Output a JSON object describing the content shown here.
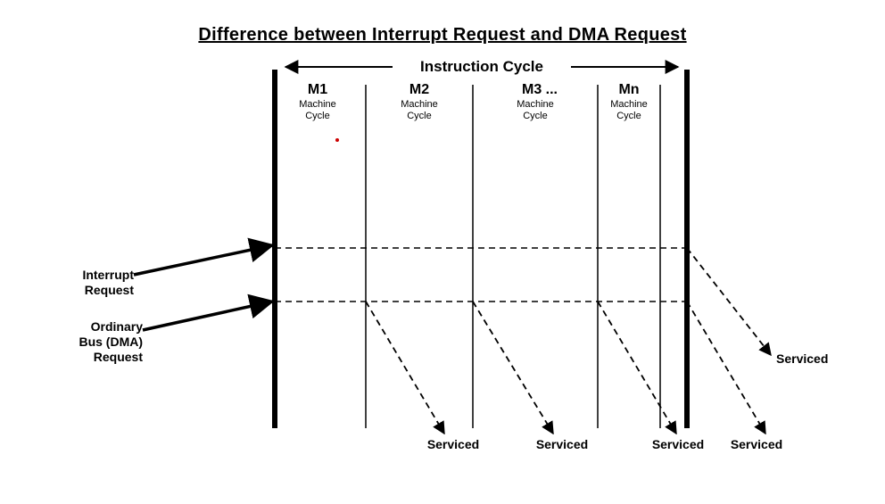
{
  "title": "Difference between Interrupt Request and DMA Request",
  "top_label": "Instruction Cycle",
  "cycles": [
    {
      "name": "M1",
      "sub1": "Machine",
      "sub2": "Cycle"
    },
    {
      "name": "M2",
      "sub1": "Machine",
      "sub2": "Cycle"
    },
    {
      "name": "M3 ...",
      "sub1": "Machine",
      "sub2": "Cycle"
    },
    {
      "name": "Mn",
      "sub1": "Machine",
      "sub2": "Cycle"
    }
  ],
  "left_labels": {
    "interrupt_l1": "Interrupt",
    "interrupt_l2": "Request",
    "dma_l1": "Ordinary",
    "dma_l2": "Bus (DMA)",
    "dma_l3": "Request"
  },
  "serviced_top": "Serviced",
  "serviced_bottom": [
    "Serviced",
    "Serviced",
    "Serviced",
    "Serviced"
  ]
}
